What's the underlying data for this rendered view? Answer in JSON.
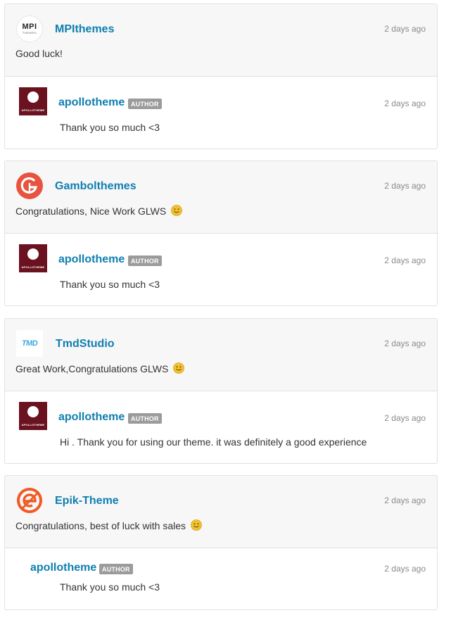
{
  "threads": [
    {
      "comment": {
        "author": "MPIthemes",
        "logo": {
          "big": "MPI",
          "small": "THEMES"
        },
        "time": "2 days ago",
        "text": "Good luck!",
        "smiley": false
      },
      "reply": {
        "author": "apollotheme",
        "badge": "AUTHOR",
        "logo_word": "APOLLOTHEME",
        "time": "2 days ago",
        "text": "Thank you so much <3",
        "show_avatar": true
      }
    },
    {
      "comment": {
        "author": "Gambolthemes",
        "time": "2 days ago",
        "text": "Congratulations, Nice Work GLWS",
        "smiley": true
      },
      "reply": {
        "author": "apollotheme",
        "badge": "AUTHOR",
        "logo_word": "APOLLOTHEME",
        "time": "2 days ago",
        "text": "Thank you so much <3",
        "show_avatar": true
      }
    },
    {
      "comment": {
        "author": "TmdStudio",
        "logo": {
          "word": "TMD"
        },
        "time": "2 days ago",
        "text": "Great Work,Congratulations GLWS",
        "smiley": true
      },
      "reply": {
        "author": "apollotheme",
        "badge": "AUTHOR",
        "logo_word": "APOLLOTHEME",
        "time": "2 days ago",
        "text": "Hi . Thank you for using our theme. it was definitely a good experience",
        "show_avatar": true
      }
    },
    {
      "comment": {
        "author": "Epik-Theme",
        "time": "2 days ago",
        "text": "Congratulations, best of luck with sales",
        "smiley": true
      },
      "reply": {
        "author": "apollotheme",
        "badge": "AUTHOR",
        "time": "2 days ago",
        "text": "Thank you so much <3",
        "show_avatar": false
      }
    }
  ],
  "colors": {
    "author_link": "#0f7fb0",
    "badge_bg": "#9b9b9b",
    "comment_bg": "#f7f7f7",
    "apollo_logo": "#6b1220",
    "gambol_logo": "#e8533f",
    "epik_logo": "#f15a24",
    "smiley": "#f2c130"
  }
}
